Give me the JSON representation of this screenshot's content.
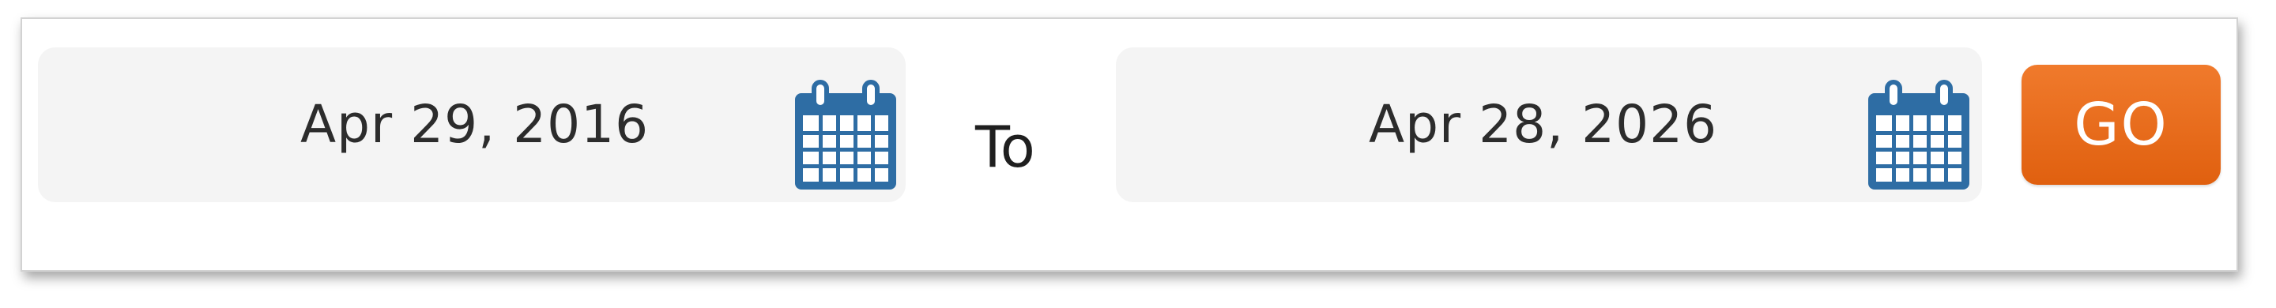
{
  "date_range": {
    "from_date": "Apr 29, 2016",
    "separator": "To",
    "to_date": "Apr 28, 2026",
    "go_label": "GO"
  },
  "icons": {
    "from_calendar": "calendar-icon",
    "to_calendar": "calendar-icon"
  },
  "colors": {
    "calendar_blue": "#2e6da4",
    "go_orange": "#e8691b"
  }
}
